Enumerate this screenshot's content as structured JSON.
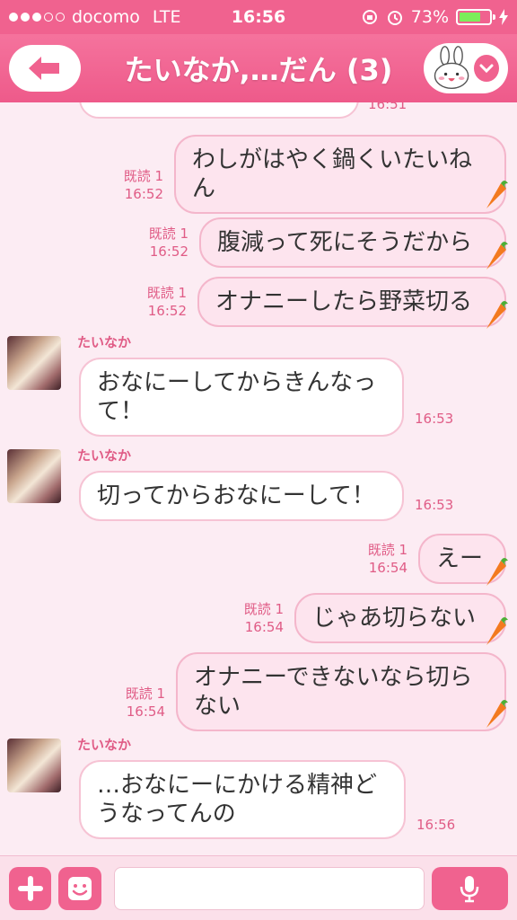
{
  "status_bar": {
    "carrier": "docomo",
    "network": "LTE",
    "time": "16:56",
    "battery": "73%",
    "battery_level": 0.73
  },
  "header": {
    "title": "たいなか,…だん (3)"
  },
  "messages": [
    {
      "dir": "out",
      "text": "わしがはやく鍋くいたいねん",
      "read": "既読 1",
      "time": "16:52"
    },
    {
      "dir": "out",
      "text": "腹減って死にそうだから",
      "read": "既読 1",
      "time": "16:52"
    },
    {
      "dir": "out",
      "text": "オナニーしたら野菜切る",
      "read": "既読 1",
      "time": "16:52"
    },
    {
      "dir": "in",
      "sender": "たいなか",
      "text": "おなにーしてからきんなって！",
      "time": "16:53"
    },
    {
      "dir": "in",
      "sender": "たいなか",
      "text": "切ってからおなにーして！",
      "time": "16:53"
    },
    {
      "dir": "out",
      "text": "えー",
      "read": "既読 1",
      "time": "16:54"
    },
    {
      "dir": "out",
      "text": "じゃあ切らない",
      "read": "既読 1",
      "time": "16:54"
    },
    {
      "dir": "out",
      "text": "オナニーできないなら切らない",
      "read": "既読 1",
      "time": "16:54"
    },
    {
      "dir": "in",
      "sender": "たいなか",
      "text": "…おなにーにかける精神どうなってんの",
      "time": "16:56"
    }
  ],
  "partial_time": "16:51",
  "input": {
    "placeholder": ""
  },
  "colors": {
    "accent": "#f0628f",
    "bubble_out": "#fde4ee",
    "bubble_in": "#ffffff",
    "background": "#fcecf3",
    "meta_text": "#e05c86"
  },
  "icons": {
    "back": "arrow-left-icon",
    "sticker_menu": "bunny-icon",
    "add": "plus-icon",
    "emoji": "smile-icon",
    "mic": "mic-icon",
    "stamp": "carrot-icon"
  }
}
